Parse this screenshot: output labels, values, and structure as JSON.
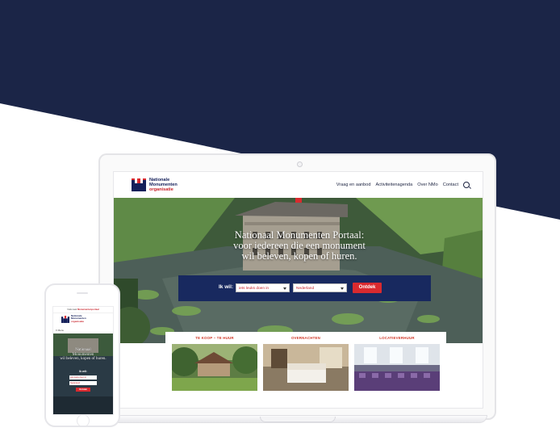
{
  "colors": {
    "navy_band": "#1b2547",
    "brand_navy": "#15205a",
    "brand_red": "#d92a2f",
    "search_panel": "#18295f",
    "card_heading": "#d13a2a"
  },
  "laptop_site": {
    "logo": {
      "line1": "Nationale",
      "line2": "Monumenten",
      "line3": "organisatie"
    },
    "nav": {
      "items": [
        {
          "label": "Vraag en aanbod"
        },
        {
          "label": "Activiteitenagenda"
        },
        {
          "label": "Over NMo"
        },
        {
          "label": "Contact"
        }
      ],
      "search_icon": "search-icon"
    },
    "hero": {
      "title_line1": "Nationaal Monumenten Portaal:",
      "title_line2": "voor iedereen die een monument",
      "title_line3": "wil beleven, kopen of huren."
    },
    "search": {
      "label": "Ik wil:",
      "select1": "iets leuks doen in",
      "select2": "Nederland",
      "button": "Ontdek"
    },
    "cards": [
      {
        "title": "TE KOOP – TE HUUR"
      },
      {
        "title": "OVERNACHTEN"
      },
      {
        "title": "LOCATIEVERHUUR"
      }
    ]
  },
  "phone_site": {
    "topbar_prefix": "Nationaal",
    "topbar_brand": "Monumentenportaal",
    "logo": {
      "line1": "Nationale",
      "line2": "Monumenten",
      "line3": "organisatie"
    },
    "menu": "≡ Menu",
    "hero": {
      "title_line1": "Nationaal",
      "title_line2": "Monumenten",
      "title_line3": "wil beleven, kopen of huren."
    },
    "search": {
      "label": "Ik wil:",
      "select1": "iets leuks doen in",
      "select2": "Nederland",
      "button": "Ontdek"
    }
  }
}
